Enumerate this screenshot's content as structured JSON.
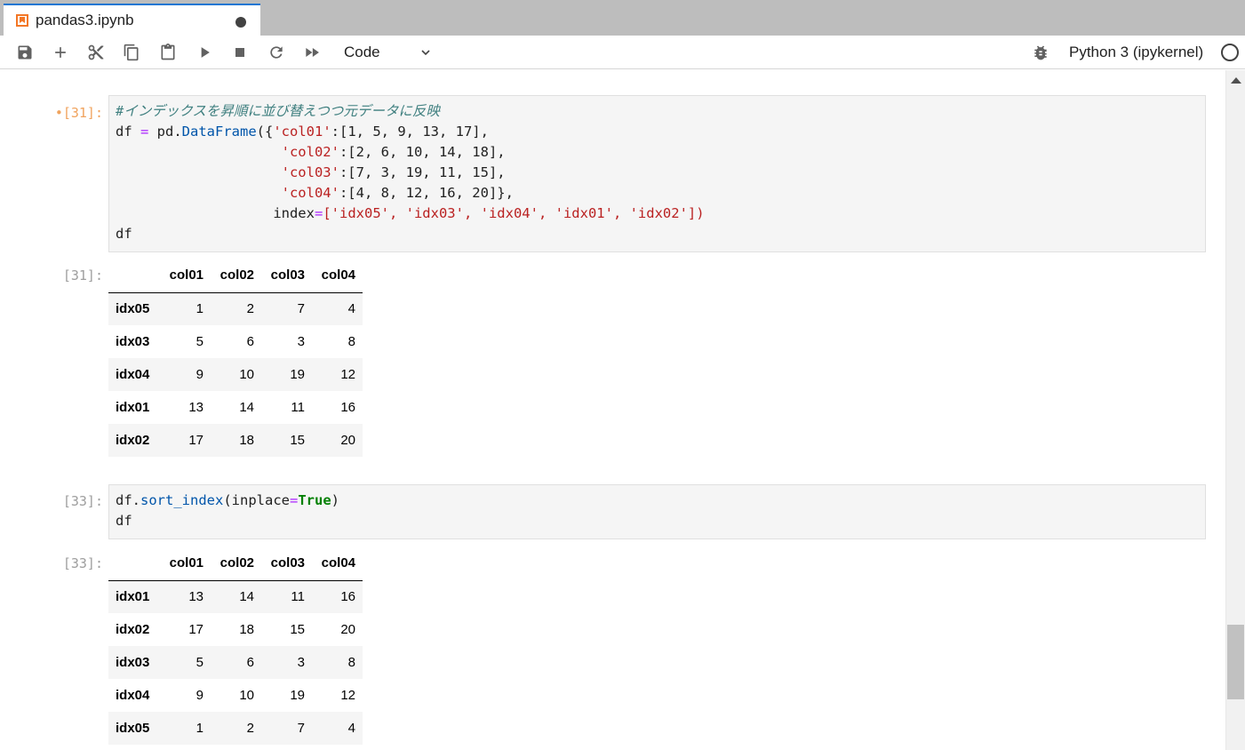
{
  "tab": {
    "title": "pandas3.ipynb"
  },
  "toolbar": {
    "buttons": [
      "save-icon",
      "add-cell-icon",
      "cut-icon",
      "copy-icon",
      "paste-icon",
      "run-icon",
      "stop-icon",
      "restart-icon",
      "run-all-icon"
    ],
    "cell_type": "Code",
    "kernel_name": "Python 3 (ipykernel)"
  },
  "cells": {
    "c1": {
      "in_prompt": "•[31]:",
      "out_prompt": "[31]:"
    },
    "c2": {
      "in_prompt": "[33]:",
      "out_prompt": "[33]:"
    }
  },
  "df1": {
    "columns": [
      "",
      "col01",
      "col02",
      "col03",
      "col04"
    ],
    "rows": [
      [
        "idx05",
        "1",
        "2",
        "7",
        "4"
      ],
      [
        "idx03",
        "5",
        "6",
        "3",
        "8"
      ],
      [
        "idx04",
        "9",
        "10",
        "19",
        "12"
      ],
      [
        "idx01",
        "13",
        "14",
        "11",
        "16"
      ],
      [
        "idx02",
        "17",
        "18",
        "15",
        "20"
      ]
    ]
  },
  "df2": {
    "columns": [
      "",
      "col01",
      "col02",
      "col03",
      "col04"
    ],
    "rows": [
      [
        "idx01",
        "13",
        "14",
        "11",
        "16"
      ],
      [
        "idx02",
        "17",
        "18",
        "15",
        "20"
      ],
      [
        "idx03",
        "5",
        "6",
        "3",
        "8"
      ],
      [
        "idx04",
        "9",
        "10",
        "19",
        "12"
      ],
      [
        "idx05",
        "1",
        "2",
        "7",
        "4"
      ]
    ]
  },
  "code1": {
    "comment": "#インデックスを昇順に並び替えつつ元データに反映",
    "l2a": "df ",
    "eq": "=",
    "l2b": " pd.",
    "fn": "DataFrame",
    "l2c": "({",
    "s1": "'col01'",
    "v1": ":[1, 5, 9, 13, 17],",
    "s2": "'col02'",
    "v2": ":[2, 6, 10, 14, 18],",
    "s3": "'col03'",
    "v3": ":[7, 3, 19, 11, 15],",
    "s4": "'col04'",
    "v4": ":[4, 8, 12, 16, 20]},",
    "idx_kw": "index",
    "idx_list": "['idx05', 'idx03', 'idx04', 'idx01', 'idx02'])",
    "last": "df"
  },
  "code2": {
    "pre": "df.",
    "fn": "sort_index",
    "open": "(inplace",
    "eq": "=",
    "kw": "True",
    "close": ")",
    "last": "df"
  },
  "colors": {
    "accent": "#1976d2",
    "notebook_icon": "#f37726",
    "string": "#ba2121",
    "number": "#008000",
    "comment": "#408080"
  }
}
